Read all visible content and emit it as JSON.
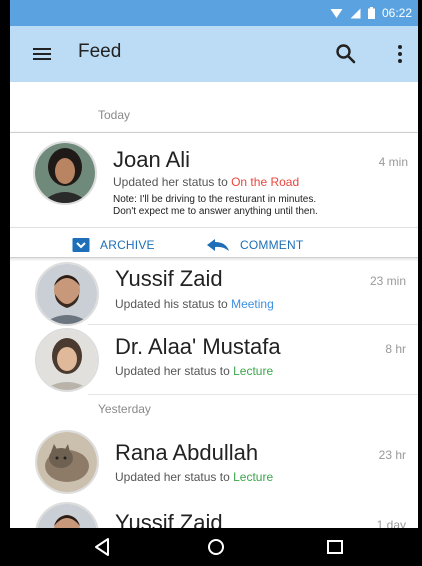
{
  "status_bar": {
    "time": "06:22"
  },
  "app_bar": {
    "title": "Feed"
  },
  "sections": {
    "today": "Today",
    "yesterday": "Yesterday"
  },
  "feed": [
    {
      "name": "Joan Ali",
      "time": "4 min",
      "status_prefix": "Updated her status to",
      "status_value": "On the Road",
      "status_color": "#e8453c",
      "note_line1": "Note: I'll be driving to the resturant in minutes.",
      "note_line2": "Don't expect me to answer anything until then."
    },
    {
      "name": "Yussif Zaid",
      "time": "23 min",
      "status_prefix": "Updated his status to",
      "status_value": "Meeting",
      "status_color": "#3d8fe0"
    },
    {
      "name": "Dr. Alaa' Mustafa",
      "time": "8 hr",
      "status_prefix": "Updated her status to",
      "status_value": "Lecture",
      "status_color": "#3aa64b"
    },
    {
      "name": "Rana Abdullah",
      "time": "23 hr",
      "status_prefix": "Updated her status to",
      "status_value": "Lecture",
      "status_color": "#3aa64b"
    },
    {
      "name": "Yussif Zaid",
      "time": "1 day"
    }
  ],
  "card_actions": {
    "archive": "ARCHIVE",
    "comment": "COMMENT"
  },
  "colors": {
    "status_bar": "#5aa3e0",
    "app_bar": "#bcdcf6",
    "accent": "#1e6fb8"
  }
}
